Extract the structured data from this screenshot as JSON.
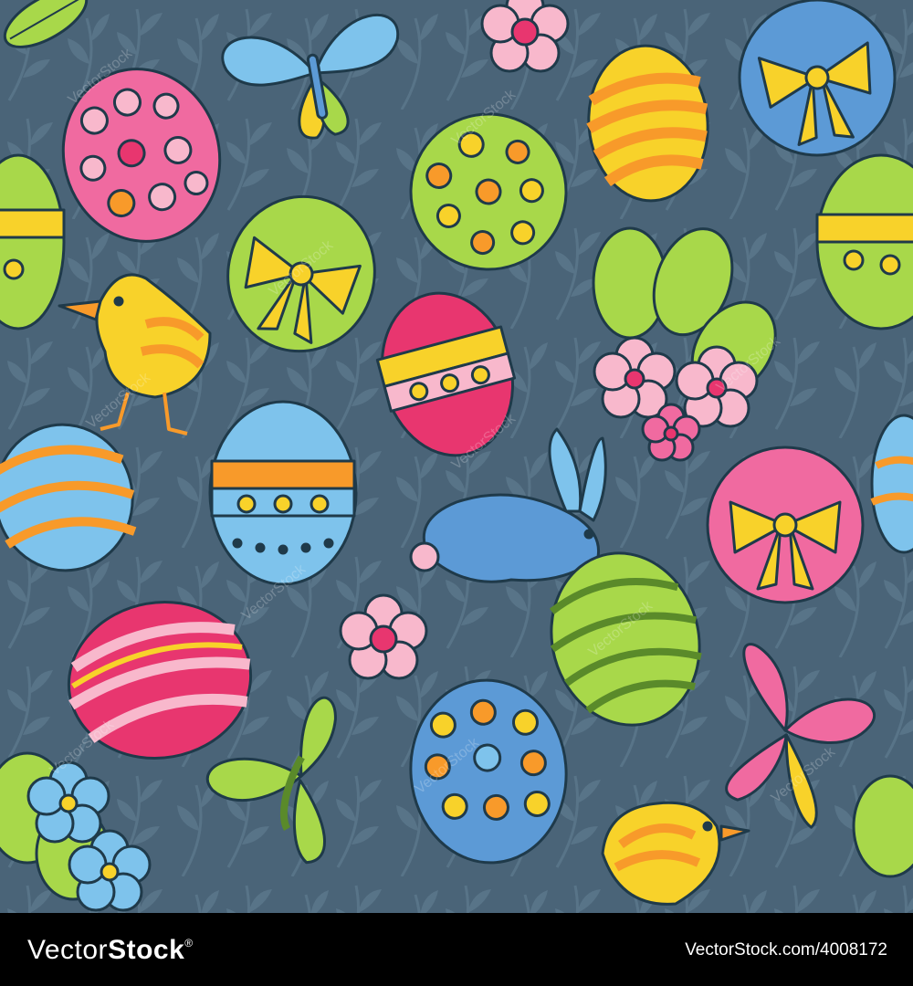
{
  "watermark": {
    "text": "VectorStock"
  },
  "footer": {
    "brand_light": "Vector",
    "brand_bold": "Stock",
    "brand_mark": "®",
    "url": "VectorStock.com/4008172"
  },
  "colors": {
    "background": "#4a6478",
    "leaf_pattern": "#587488",
    "outline": "#1f3a4a",
    "pink": "#f06aa0",
    "hot_pink": "#e8366f",
    "green": "#a8d84a",
    "yellow": "#f8d22a",
    "orange": "#f89a2a",
    "light_blue": "#7ec3ec",
    "blue": "#5c9ad6",
    "pale_pink": "#f8b8cc"
  },
  "icons": [
    "egg-icon",
    "butterfly-icon",
    "chick-icon",
    "bunny-icon",
    "flower-icon",
    "leaf-icon",
    "bow-icon"
  ]
}
